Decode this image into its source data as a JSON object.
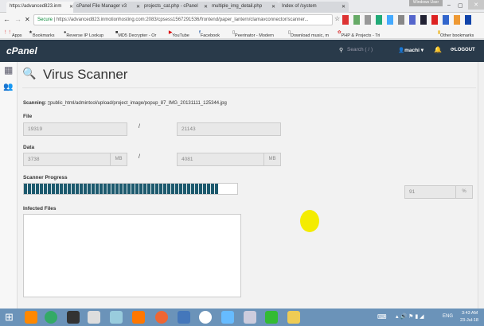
{
  "browser": {
    "tabs": [
      "https://advanced823.inm",
      "cPanel File Manager v3",
      "projects_cat.php - cPanel",
      "multiple_img_detail.php",
      "Index of /system"
    ],
    "window_title": "Windows User",
    "secure_label": "Secure",
    "url": "https://advanced823.inmotionhosting.com:2083/cpsess1567291536/frontend/paper_lantern/clamavconnector/scanner...",
    "bookmarks": [
      "Apps",
      "Bookmarks",
      "Reverse IP Lookup",
      "MD5 Decrypter - Or",
      "YouTube",
      "Facebook",
      "Peerinator - Modern",
      "Download music, m",
      "PHP & Projects - Tri",
      "Other bookmarks"
    ]
  },
  "header": {
    "logo": "cPanel",
    "search_placeholder": "Search ( / )",
    "user": "machi",
    "logout": "LOGOUT"
  },
  "page": {
    "title": "Virus Scanner",
    "scanning_label": "Scanning:",
    "scanning_path": "public_html/admintool/upload/project_image/popup_87_IMG_20131111_125344.jpg",
    "file_label": "File",
    "file_current": "19319",
    "file_total": "21143",
    "separator": "/",
    "data_label": "Data",
    "data_current": "3738",
    "data_total": "4081",
    "unit": "MB",
    "progress_label": "Scanner Progress",
    "progress_percent": 91,
    "percent_value": "91",
    "percent_unit": "%",
    "infected_label": "Infected Files"
  },
  "taskbar": {
    "lang": "ENG",
    "time": "3:43 AM",
    "date": "23-Jul-18"
  }
}
